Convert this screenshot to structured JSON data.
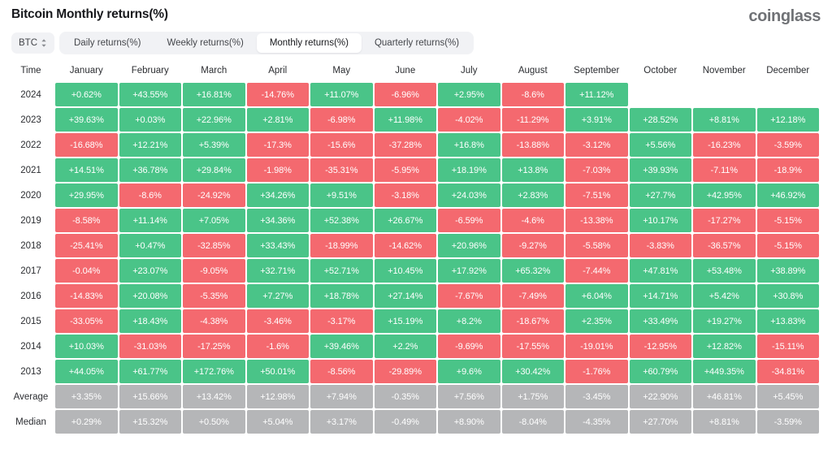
{
  "header": {
    "title": "Bitcoin Monthly returns(%)",
    "brand": "coinglass"
  },
  "controls": {
    "symbol": {
      "label": "BTC",
      "icon": "updown-chevron-icon"
    },
    "tabs": [
      {
        "label": "Daily returns(%)",
        "active": false
      },
      {
        "label": "Weekly returns(%)",
        "active": false
      },
      {
        "label": "Monthly returns(%)",
        "active": true
      },
      {
        "label": "Quarterly returns(%)",
        "active": false
      }
    ]
  },
  "colors": {
    "up": "#4ac488",
    "down": "#f4696f",
    "flat": "#b5b6b8",
    "brand": "#707276",
    "tab_bar": "#f1f2f5"
  },
  "chart_data": {
    "type": "heatmap",
    "title": "Bitcoin Monthly returns(%)",
    "xlabel": "",
    "ylabel": "Time",
    "row_header": "Time",
    "categories": [
      "January",
      "February",
      "March",
      "April",
      "May",
      "June",
      "July",
      "August",
      "September",
      "October",
      "November",
      "December"
    ],
    "rows": [
      {
        "label": "2024",
        "kind": "year",
        "values": [
          "+0.62%",
          "+43.55%",
          "+16.81%",
          "-14.76%",
          "+11.07%",
          "-6.96%",
          "+2.95%",
          "-8.6%",
          "+11.12%",
          "",
          "",
          ""
        ]
      },
      {
        "label": "2023",
        "kind": "year",
        "values": [
          "+39.63%",
          "+0.03%",
          "+22.96%",
          "+2.81%",
          "-6.98%",
          "+11.98%",
          "-4.02%",
          "-11.29%",
          "+3.91%",
          "+28.52%",
          "+8.81%",
          "+12.18%"
        ]
      },
      {
        "label": "2022",
        "kind": "year",
        "values": [
          "-16.68%",
          "+12.21%",
          "+5.39%",
          "-17.3%",
          "-15.6%",
          "-37.28%",
          "+16.8%",
          "-13.88%",
          "-3.12%",
          "+5.56%",
          "-16.23%",
          "-3.59%"
        ]
      },
      {
        "label": "2021",
        "kind": "year",
        "values": [
          "+14.51%",
          "+36.78%",
          "+29.84%",
          "-1.98%",
          "-35.31%",
          "-5.95%",
          "+18.19%",
          "+13.8%",
          "-7.03%",
          "+39.93%",
          "-7.11%",
          "-18.9%"
        ]
      },
      {
        "label": "2020",
        "kind": "year",
        "values": [
          "+29.95%",
          "-8.6%",
          "-24.92%",
          "+34.26%",
          "+9.51%",
          "-3.18%",
          "+24.03%",
          "+2.83%",
          "-7.51%",
          "+27.7%",
          "+42.95%",
          "+46.92%"
        ]
      },
      {
        "label": "2019",
        "kind": "year",
        "values": [
          "-8.58%",
          "+11.14%",
          "+7.05%",
          "+34.36%",
          "+52.38%",
          "+26.67%",
          "-6.59%",
          "-4.6%",
          "-13.38%",
          "+10.17%",
          "-17.27%",
          "-5.15%"
        ]
      },
      {
        "label": "2018",
        "kind": "year",
        "values": [
          "-25.41%",
          "+0.47%",
          "-32.85%",
          "+33.43%",
          "-18.99%",
          "-14.62%",
          "+20.96%",
          "-9.27%",
          "-5.58%",
          "-3.83%",
          "-36.57%",
          "-5.15%"
        ]
      },
      {
        "label": "2017",
        "kind": "year",
        "values": [
          "-0.04%",
          "+23.07%",
          "-9.05%",
          "+32.71%",
          "+52.71%",
          "+10.45%",
          "+17.92%",
          "+65.32%",
          "-7.44%",
          "+47.81%",
          "+53.48%",
          "+38.89%"
        ]
      },
      {
        "label": "2016",
        "kind": "year",
        "values": [
          "-14.83%",
          "+20.08%",
          "-5.35%",
          "+7.27%",
          "+18.78%",
          "+27.14%",
          "-7.67%",
          "-7.49%",
          "+6.04%",
          "+14.71%",
          "+5.42%",
          "+30.8%"
        ]
      },
      {
        "label": "2015",
        "kind": "year",
        "values": [
          "-33.05%",
          "+18.43%",
          "-4.38%",
          "-3.46%",
          "-3.17%",
          "+15.19%",
          "+8.2%",
          "-18.67%",
          "+2.35%",
          "+33.49%",
          "+19.27%",
          "+13.83%"
        ]
      },
      {
        "label": "2014",
        "kind": "year",
        "values": [
          "+10.03%",
          "-31.03%",
          "-17.25%",
          "-1.6%",
          "+39.46%",
          "+2.2%",
          "-9.69%",
          "-17.55%",
          "-19.01%",
          "-12.95%",
          "+12.82%",
          "-15.11%"
        ]
      },
      {
        "label": "2013",
        "kind": "year",
        "values": [
          "+44.05%",
          "+61.77%",
          "+172.76%",
          "+50.01%",
          "-8.56%",
          "-29.89%",
          "+9.6%",
          "+30.42%",
          "-1.76%",
          "+60.79%",
          "+449.35%",
          "-34.81%"
        ]
      },
      {
        "label": "Average",
        "kind": "summary",
        "values": [
          "+3.35%",
          "+15.66%",
          "+13.42%",
          "+12.98%",
          "+7.94%",
          "-0.35%",
          "+7.56%",
          "+1.75%",
          "-3.45%",
          "+22.90%",
          "+46.81%",
          "+5.45%"
        ]
      },
      {
        "label": "Median",
        "kind": "summary",
        "values": [
          "+0.29%",
          "+15.32%",
          "+0.50%",
          "+5.04%",
          "+3.17%",
          "-0.49%",
          "+8.90%",
          "-8.04%",
          "-4.35%",
          "+27.70%",
          "+8.81%",
          "-3.59%"
        ]
      }
    ]
  }
}
